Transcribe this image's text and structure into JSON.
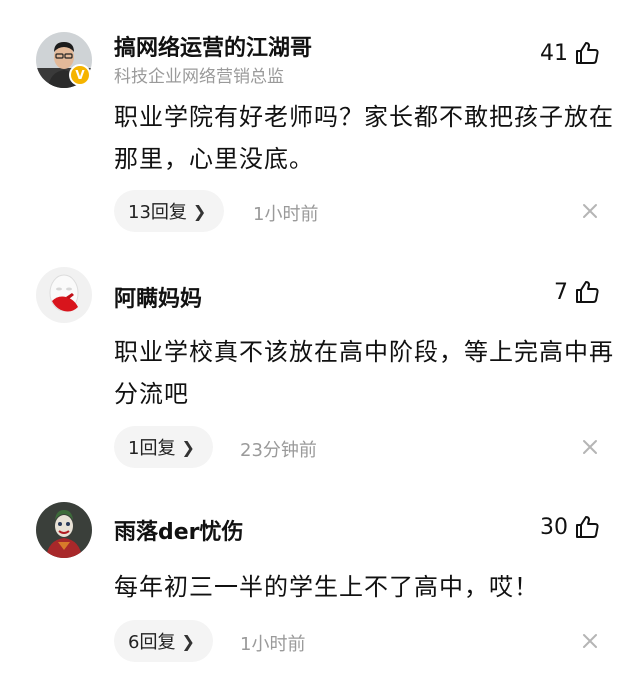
{
  "comments": [
    {
      "name": "搞网络运营的江湖哥",
      "subtitle": "科技企业网络营销总监",
      "verified": true,
      "verified_badge": "V",
      "likes": "41",
      "content": "职业学院有好老师吗？家长都不敢把孩子放在那里，心里没底。",
      "replies": "13回复",
      "time": "1小时前",
      "avatar_icon": "man-portrait"
    },
    {
      "name": "阿瞒妈妈",
      "subtitle": "",
      "verified": false,
      "likes": "7",
      "content": "职业学校真不该放在高中阶段，等上完高中再分流吧",
      "replies": "1回复",
      "time": "23分钟前",
      "avatar_icon": "mannequin-red-hand"
    },
    {
      "name": "雨落der忧伤",
      "subtitle": "",
      "verified": false,
      "likes": "30",
      "content": "每年初三一半的学生上不了高中，哎！",
      "replies": "6回复",
      "time": "1小时前",
      "avatar_icon": "joker-portrait"
    }
  ],
  "icons": {
    "like": "thumbs-up-icon",
    "reply_chevron": "chevron-right-icon",
    "dismiss": "close-icon"
  },
  "colors": {
    "verified_badge": "#f5b400",
    "secondary_text": "#9a9a9a",
    "reply_pill": "#f4f4f4"
  }
}
